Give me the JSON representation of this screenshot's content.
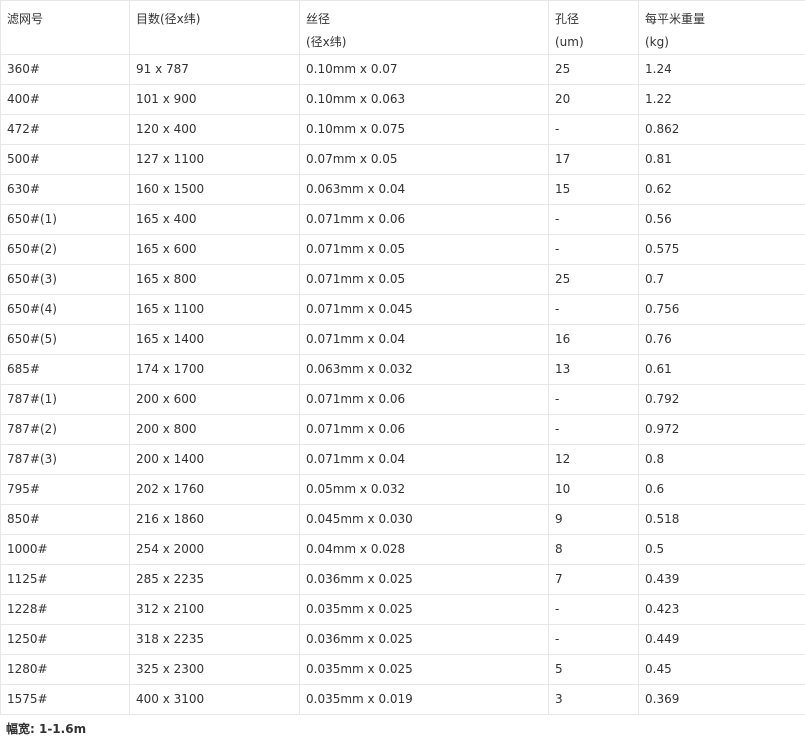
{
  "table": {
    "headers": [
      {
        "line1": "滤网号",
        "line2": ""
      },
      {
        "line1": "目数(径x纬)",
        "line2": ""
      },
      {
        "line1": "丝径",
        "line2": "(径x纬)"
      },
      {
        "line1": "孔径",
        "line2": "(um)"
      },
      {
        "line1": "每平米重量",
        "line2": "(kg)"
      }
    ],
    "rows": [
      [
        "360#",
        "91 x 787",
        "0.10mm x 0.07",
        "25",
        "1.24"
      ],
      [
        "400#",
        "101 x 900",
        "0.10mm x 0.063",
        "20",
        "1.22"
      ],
      [
        "472#",
        "120 x 400",
        "0.10mm x 0.075",
        "-",
        "0.862"
      ],
      [
        "500#",
        "127 x 1100",
        "0.07mm x 0.05",
        "17",
        "0.81"
      ],
      [
        "630#",
        "160 x 1500",
        "0.063mm x 0.04",
        "15",
        "0.62"
      ],
      [
        "650#(1)",
        "165 x 400",
        "0.071mm x 0.06",
        "-",
        "0.56"
      ],
      [
        "650#(2)",
        "165 x 600",
        "0.071mm x 0.05",
        "-",
        "0.575"
      ],
      [
        "650#(3)",
        "165 x 800",
        "0.071mm x 0.05",
        "25",
        "0.7"
      ],
      [
        "650#(4)",
        "165 x 1100",
        "0.071mm x 0.045",
        "-",
        "0.756"
      ],
      [
        "650#(5)",
        "165 x 1400",
        "0.071mm x 0.04",
        "16",
        "0.76"
      ],
      [
        "685#",
        "174 x 1700",
        "0.063mm x 0.032",
        "13",
        "0.61"
      ],
      [
        "787#(1)",
        "200 x 600",
        "0.071mm x 0.06",
        "-",
        "0.792"
      ],
      [
        "787#(2)",
        "200 x 800",
        "0.071mm x 0.06",
        "-",
        "0.972"
      ],
      [
        "787#(3)",
        "200 x 1400",
        "0.071mm x 0.04",
        "12",
        "0.8"
      ],
      [
        "795#",
        "202 x 1760",
        "0.05mm x 0.032",
        "10",
        "0.6"
      ],
      [
        "850#",
        "216 x 1860",
        "0.045mm x 0.030",
        "9",
        "0.518"
      ],
      [
        "1000#",
        "254 x 2000",
        "0.04mm x 0.028",
        "8",
        "0.5"
      ],
      [
        "1125#",
        "285 x 2235",
        "0.036mm x 0.025",
        "7",
        "0.439"
      ],
      [
        "1228#",
        "312 x 2100",
        "0.035mm x 0.025",
        "-",
        "0.423"
      ],
      [
        "1250#",
        "318 x 2235",
        "0.036mm x 0.025",
        "-",
        "0.449"
      ],
      [
        "1280#",
        "325 x 2300",
        "0.035mm x 0.025",
        "5",
        "0.45"
      ],
      [
        "1575#",
        "400 x 3100",
        "0.035mm x 0.019",
        "3",
        "0.369"
      ]
    ]
  },
  "footer": {
    "width_note": "幅宽: 1-1.6m"
  }
}
